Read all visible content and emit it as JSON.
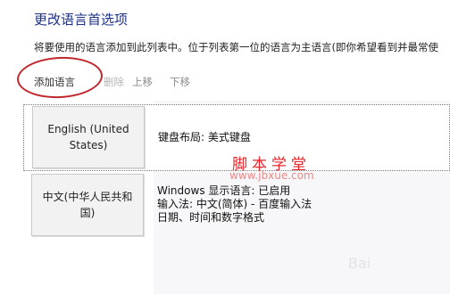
{
  "dialog": {
    "title": "更改语言首选项",
    "description": "将要使用的语言添加到此列表中。位于列表第一位的语言为主语言(即你希望看到并最常使"
  },
  "toolbar": {
    "add": "添加语言",
    "remove": "删除",
    "up": "上移",
    "down": "下移"
  },
  "languages": [
    {
      "name": "English (United States)",
      "details": [
        "键盘布局: 美式键盘"
      ]
    },
    {
      "name": "中文(中华人民共和国)",
      "details": [
        "Windows 显示语言: 已启用",
        "输入法: 中文(简体) - 百度输入法",
        "日期、时间和数字格式"
      ]
    }
  ],
  "watermark": {
    "site_name": "脚本学堂",
    "site_url": "www.jbxue.com",
    "faint": "Bai"
  },
  "colors": {
    "title": "#1e3287",
    "annotation_circle": "#c0272d",
    "watermark": "#e5272d"
  }
}
